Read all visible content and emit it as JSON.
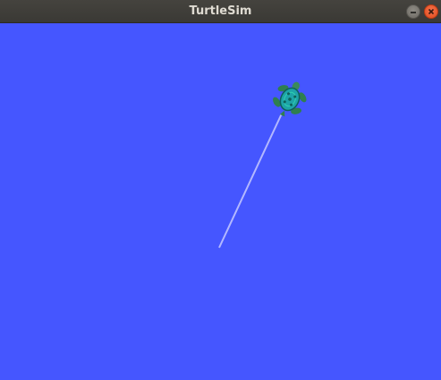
{
  "window": {
    "title": "TurtleSim"
  },
  "canvas": {
    "background_color": "#4556ff",
    "pen_color": "#b3b8ff"
  },
  "turtle": {
    "shell_color": "#1ea4a8",
    "body_color": "#3b8a5a",
    "icon": "turtle-icon"
  }
}
